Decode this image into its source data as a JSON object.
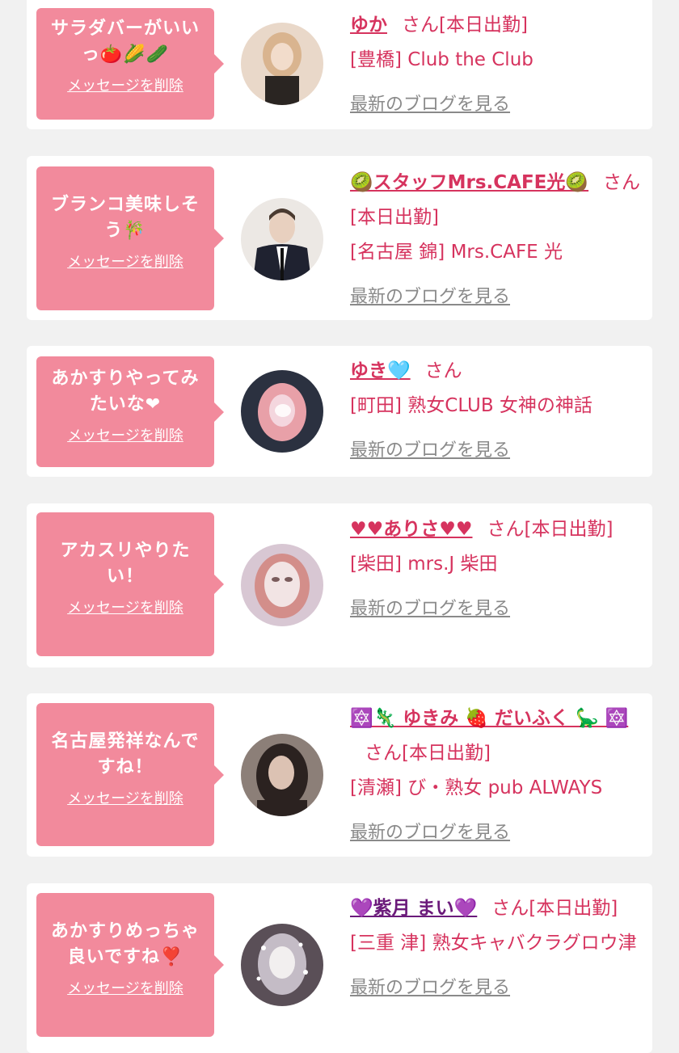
{
  "messages": [
    {
      "bubble_text": "サラダバーがいいっ🍅🌽🥒",
      "delete_label": "メッセージを削除",
      "name": "ゆか",
      "suffix": "さん[本日出勤]",
      "shop": "[豊橋] Club the Club",
      "blog_label": "最新のブログを見る",
      "avatar_colors": [
        "#e9d8c9",
        "#d9b48f",
        "#2a2522"
      ]
    },
    {
      "bubble_text": "ブランコ美味しそう🎋",
      "delete_label": "メッセージを削除",
      "name": "🥝スタッフMrs.CAFE光🥝",
      "suffix": "さん[本日出勤]",
      "shop": "[名古屋 錦] Mrs.CAFE 光",
      "blog_label": "最新のブログを見る",
      "avatar_colors": [
        "#ece8e4",
        "#1f2230",
        "#e8d0bf"
      ]
    },
    {
      "bubble_text": "あかすりやってみたいな❤",
      "delete_label": "メッセージを削除",
      "name": "ゆき🩵",
      "suffix": "さん",
      "shop": "[町田] 熟女CLUB 女神の神話",
      "blog_label": "最新のブログを見る",
      "avatar_colors": [
        "#2b3140",
        "#e8a0a8",
        "#f4d6de"
      ]
    },
    {
      "bubble_text": "アカスリやりたい！",
      "delete_label": "メッセージを削除",
      "name": "♥♥ありさ♥♥",
      "suffix": "さん[本日出勤]",
      "shop": "[柴田] mrs.J 柴田",
      "blog_label": "最新のブログを見る",
      "avatar_colors": [
        "#d8c7d3",
        "#f2e4e4",
        "#d38e8a"
      ]
    },
    {
      "bubble_text": "名古屋発祥なんですね！",
      "delete_label": "メッセージを削除",
      "name": "🔯🦎 ゆきみ 🍓 だいふく 🦕 🔯",
      "suffix": "さん[本日出勤]",
      "shop": "[清瀬] び・熟女 pub ALWAYS",
      "blog_label": "最新のブログを見る",
      "avatar_colors": [
        "#8c7f78",
        "#2b2220",
        "#dcc2b3"
      ]
    },
    {
      "bubble_text": "あかすりめっちゃ良いですね❣️",
      "delete_label": "メッセージを削除",
      "name": "💜紫月 まい💜",
      "suffix": "さん[本日出勤]",
      "shop": "[三重 津] 熟女キャバクラグロウ津",
      "blog_label": "最新のブログを見る",
      "avatar_colors": [
        "#5a4f57",
        "#c4bcc6",
        "#f2efef"
      ]
    }
  ]
}
